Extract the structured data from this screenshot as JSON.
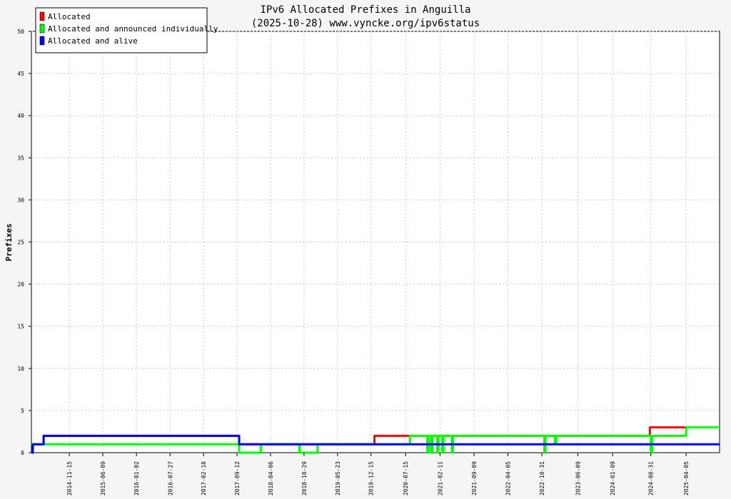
{
  "chart_data": {
    "type": "line",
    "title": "IPv6 Allocated Prefixes in Anguilla",
    "subtitle": "(2025-10-28) www.vyncke.org/ipv6status",
    "xlabel": "",
    "ylabel": "Prefixes",
    "ylim": [
      0,
      50
    ],
    "y_ticks": [
      0,
      5,
      10,
      15,
      20,
      25,
      30,
      35,
      40,
      45,
      50
    ],
    "xlim": [
      "2014-03-27",
      "2025-10-28"
    ],
    "x_ticks": [
      "2014-11-15",
      "2015-06-09",
      "2016-01-02",
      "2016-07-27",
      "2017-02-18",
      "2017-09-12",
      "2018-04-06",
      "2018-10-29",
      "2019-05-23",
      "2019-12-15",
      "2020-07-15",
      "2021-02-11",
      "2021-09-09",
      "2022-04-05",
      "2022-10-31",
      "2023-06-09",
      "2024-01-09",
      "2024-08-31",
      "2025-04-05"
    ],
    "grid": true,
    "legend_position": "top-left",
    "series": [
      {
        "name": "Allocated",
        "color": "#ff0000",
        "points": [
          [
            "2014-03-27",
            1
          ],
          [
            "2014-06-10",
            1
          ],
          [
            "2014-06-10",
            2
          ],
          [
            "2017-09-25",
            2
          ],
          [
            "2017-09-25",
            1
          ],
          [
            "2020-01-05",
            1
          ],
          [
            "2020-01-05",
            2
          ],
          [
            "2022-12-31",
            2
          ],
          [
            "2024-08-25",
            2
          ],
          [
            "2024-08-25",
            3
          ],
          [
            "2025-10-28",
            3
          ]
        ]
      },
      {
        "name": "Allocated and announced individually",
        "color": "#00ff00",
        "points": [
          [
            "2014-03-27",
            1
          ],
          [
            "2017-09-25",
            1
          ],
          [
            "2017-09-25",
            0
          ],
          [
            "2018-02-05",
            0
          ],
          [
            "2018-02-05",
            1
          ],
          [
            "2018-10-01",
            1
          ],
          [
            "2018-10-01",
            0
          ],
          [
            "2019-01-20",
            0
          ],
          [
            "2019-01-20",
            1
          ],
          [
            "2020-01-01",
            1
          ],
          [
            "2020-01-01",
            1
          ],
          [
            "2020-08-10",
            1
          ],
          [
            "2020-08-10",
            2
          ],
          [
            "2020-11-25",
            2
          ],
          [
            "2020-11-25",
            0
          ],
          [
            "2020-12-03",
            0
          ],
          [
            "2020-12-03",
            2
          ],
          [
            "2020-12-18",
            2
          ],
          [
            "2020-12-18",
            0
          ],
          [
            "2020-12-26",
            0
          ],
          [
            "2020-12-26",
            2
          ],
          [
            "2021-01-25",
            2
          ],
          [
            "2021-01-25",
            0
          ],
          [
            "2021-02-02",
            0
          ],
          [
            "2021-02-02",
            2
          ],
          [
            "2021-02-25",
            2
          ],
          [
            "2021-02-25",
            0
          ],
          [
            "2021-03-04",
            0
          ],
          [
            "2021-03-04",
            2
          ],
          [
            "2021-04-25",
            2
          ],
          [
            "2021-04-25",
            0
          ],
          [
            "2021-05-02",
            0
          ],
          [
            "2021-05-02",
            2
          ],
          [
            "2022-11-15",
            2
          ],
          [
            "2022-11-15",
            0
          ],
          [
            "2022-11-22",
            0
          ],
          [
            "2022-11-22",
            2
          ],
          [
            "2023-01-20",
            2
          ],
          [
            "2023-01-20",
            1
          ],
          [
            "2023-01-27",
            1
          ],
          [
            "2023-01-27",
            2
          ],
          [
            "2024-08-31",
            2
          ],
          [
            "2024-08-31",
            0
          ],
          [
            "2024-09-07",
            0
          ],
          [
            "2024-09-07",
            2
          ],
          [
            "2025-04-05",
            2
          ],
          [
            "2025-04-05",
            3
          ],
          [
            "2025-10-28",
            3
          ]
        ]
      },
      {
        "name": "Allocated and alive",
        "color": "#0000ff",
        "points": [
          [
            "2014-03-27",
            0
          ],
          [
            "2014-04-05",
            0
          ],
          [
            "2014-04-05",
            1
          ],
          [
            "2014-06-10",
            1
          ],
          [
            "2014-06-10",
            2
          ],
          [
            "2017-09-25",
            2
          ],
          [
            "2017-09-25",
            1
          ],
          [
            "2025-10-28",
            1
          ]
        ]
      }
    ]
  }
}
